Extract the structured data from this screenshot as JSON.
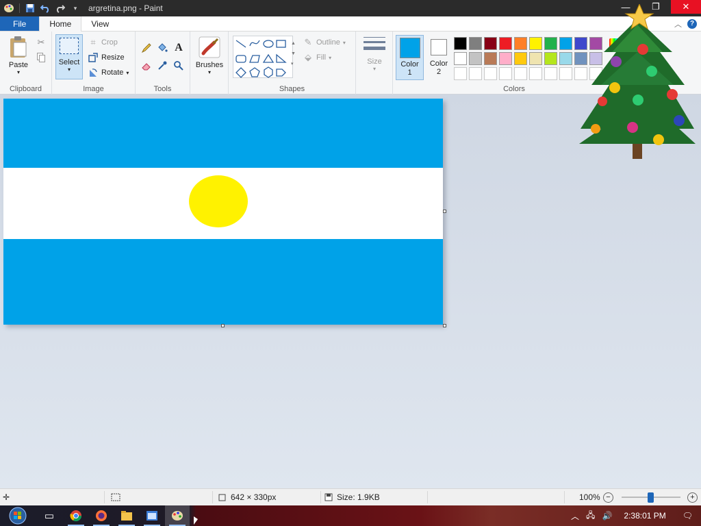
{
  "window": {
    "title": "argretina.png - Paint",
    "controls": {
      "minimize": "—",
      "maximize": "❐",
      "close": "✕"
    }
  },
  "tabs": [
    {
      "label": "File"
    },
    {
      "label": "Home"
    },
    {
      "label": "View"
    }
  ],
  "ribbon": {
    "clipboard": {
      "paste": "Paste",
      "group": "Clipboard"
    },
    "image": {
      "select": "Select",
      "crop": "Crop",
      "resize": "Resize",
      "rotate": "Rotate",
      "group": "Image"
    },
    "tools": {
      "group": "Tools"
    },
    "brushes": {
      "label": "Brushes"
    },
    "shapes": {
      "outline": "Outline",
      "fill": "Fill",
      "group": "Shapes"
    },
    "size": {
      "label": "Size"
    },
    "colors": {
      "color1": "Color\n1",
      "color1_a": "Color",
      "color1_b": "1",
      "color2_a": "Color",
      "color2_b": "2",
      "group": "Colors",
      "color1_value": "#00a2e8",
      "color2_value": "#ffffff",
      "palette_row1": [
        "#000000",
        "#7f7f7f",
        "#880015",
        "#ed1c24",
        "#ff7f27",
        "#fff200",
        "#22b14c",
        "#00a2e8",
        "#3f48cc",
        "#a349a4"
      ],
      "palette_row2": [
        "#ffffff",
        "#c3c3c3",
        "#b97a57",
        "#ffaec9",
        "#ffc90e",
        "#efe4b0",
        "#b5e61d",
        "#99d9ea",
        "#7092be",
        "#c8bfe7"
      ]
    }
  },
  "canvas": {
    "flag_colors": {
      "stripe": "#00a2e8",
      "middle": "#ffffff",
      "sun": "#fff200"
    }
  },
  "status": {
    "dimensions": "642 × 330px",
    "size": "Size: 1.9KB",
    "zoom": "100%",
    "zoom_level": 0.5
  },
  "taskbar": {
    "time": "2:38:01 PM"
  }
}
